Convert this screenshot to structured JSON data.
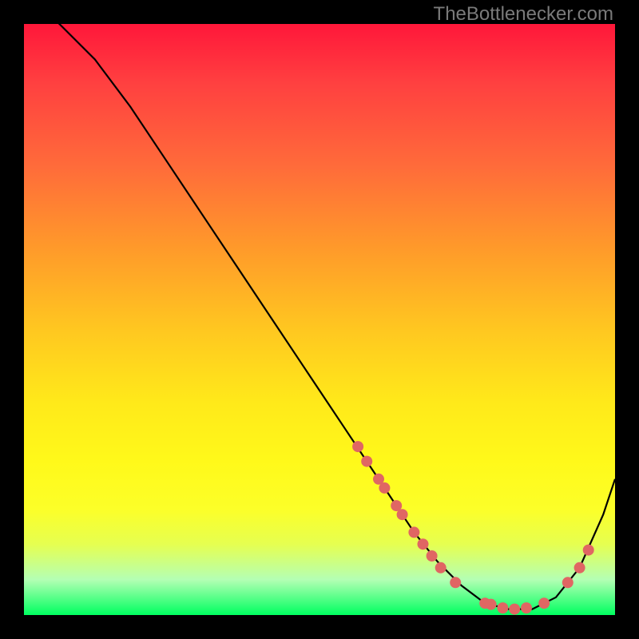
{
  "attribution": "TheBottlenecker.com",
  "chart_data": {
    "type": "line",
    "title": "",
    "xlabel": "",
    "ylabel": "",
    "xlim": [
      0,
      100
    ],
    "ylim": [
      0,
      100
    ],
    "curve": {
      "x": [
        0,
        6,
        12,
        18,
        24,
        30,
        36,
        42,
        48,
        54,
        58,
        62,
        66,
        70,
        74,
        78,
        82,
        86,
        90,
        94,
        98,
        100
      ],
      "y": [
        105,
        100,
        94,
        86,
        77,
        68,
        59,
        50,
        41,
        32,
        26,
        20,
        14,
        9,
        5,
        2,
        1,
        1,
        3,
        8,
        17,
        23
      ]
    },
    "markers": [
      {
        "x": 56.5,
        "y": 28.5
      },
      {
        "x": 58.0,
        "y": 26.0
      },
      {
        "x": 60.0,
        "y": 23.0
      },
      {
        "x": 61.0,
        "y": 21.5
      },
      {
        "x": 63.0,
        "y": 18.5
      },
      {
        "x": 64.0,
        "y": 17.0
      },
      {
        "x": 66.0,
        "y": 14.0
      },
      {
        "x": 67.5,
        "y": 12.0
      },
      {
        "x": 69.0,
        "y": 10.0
      },
      {
        "x": 70.5,
        "y": 8.0
      },
      {
        "x": 73.0,
        "y": 5.5
      },
      {
        "x": 78.0,
        "y": 2.0
      },
      {
        "x": 79.0,
        "y": 1.8
      },
      {
        "x": 81.0,
        "y": 1.2
      },
      {
        "x": 83.0,
        "y": 1.0
      },
      {
        "x": 85.0,
        "y": 1.2
      },
      {
        "x": 88.0,
        "y": 2.0
      },
      {
        "x": 92.0,
        "y": 5.5
      },
      {
        "x": 94.0,
        "y": 8.0
      },
      {
        "x": 95.5,
        "y": 11.0
      }
    ],
    "marker_color": "#e06663",
    "line_color": "#000000"
  }
}
